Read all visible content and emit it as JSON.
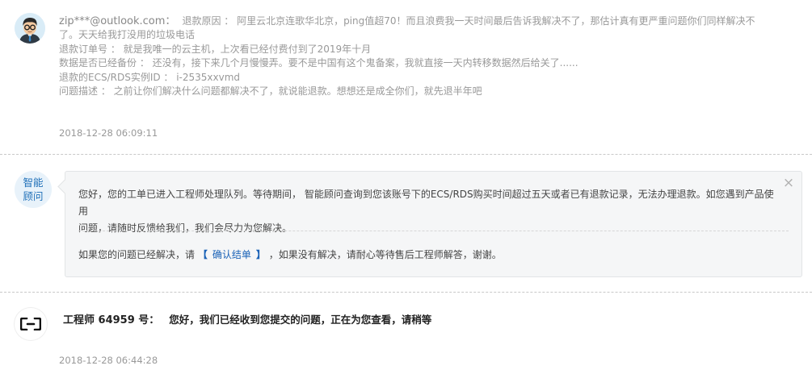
{
  "message1": {
    "email": "zip***@outlook.com：",
    "lines": [
      "退款原因 ： 阿里云北京连歌华北京，ping值超70！而且浪费我一天时间最后告诉我解决不了，那估计真有更严重问题你们同样解决不",
      "了。天天给我打没用的垃圾电话",
      "退款订单号 ： 就是我唯一的云主机，上次看已经付费付到了2019年十月",
      "数据是否已经备份 ： 还没有，接下来几个月慢慢弄。要不是中国有这个鬼备案，我就直接一天内转移数据然后给关了......",
      "退款的ECS/RDS实例ID ： i-2535xxvmd",
      "问题描述 ： 之前让你们解决什么问题都解决不了，就说能退款。想想还是成全你们，就先退半年吧"
    ],
    "timestamp": "2018-12-28 06:09:11"
  },
  "message2": {
    "avatar_label": "智能顾问",
    "text_line1": "您好，您的工单已进入工程师处理队列。等待期间， 智能顾问查询到您该账号下的ECS/RDS购买时间超过五天或者已有退款记录，无法办理退款。如您遇到产品使用",
    "text_line2": "问题，请随时反馈给我们，我们会尽力为您解决。",
    "footer_prefix": "如果您的问题已经解决，请",
    "bracket_open": "【",
    "confirm_link": "确认结单",
    "bracket_close": "】",
    "footer_suffix": "，如果没有解决，请耐心等待售后工程师解答，谢谢。",
    "close_symbol": "×"
  },
  "message3": {
    "engineer_name": "工程师 64959 号：",
    "engineer_message": "您好，我们已经收到您提交的问题，正在为您查看，请稍等",
    "timestamp": "2018-12-28 06:44:28"
  },
  "icons": {
    "user_avatar": "cartoon-man-glasses-avatar",
    "engineer_avatar": "aliyun-logo-icon",
    "close": "close-icon"
  },
  "colors": {
    "link": "#1a62b7",
    "advisor_label": "#1e6fb8",
    "card_bg": "#f5f6f7"
  }
}
